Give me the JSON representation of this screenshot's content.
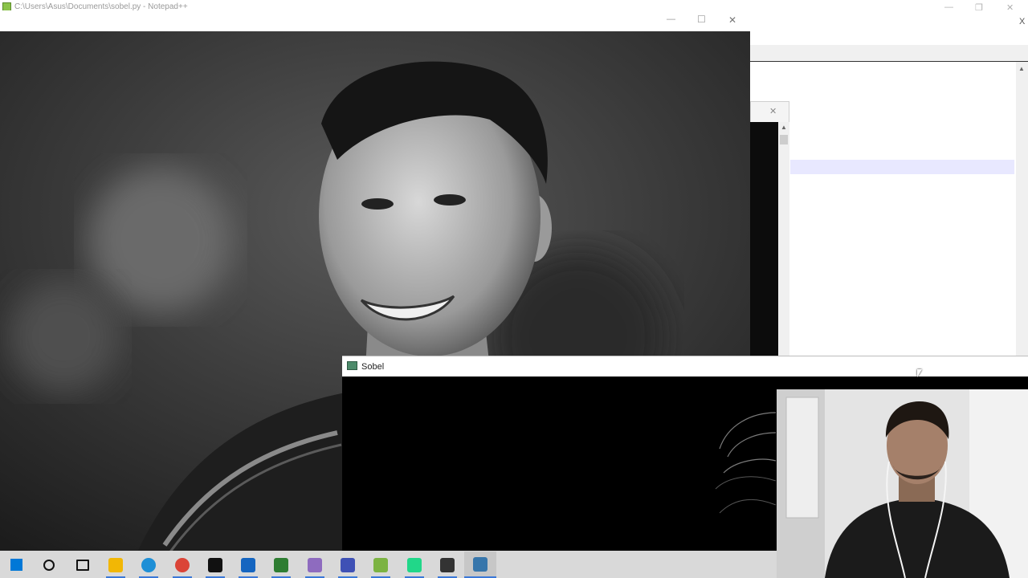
{
  "notepad": {
    "title": "C:\\Users\\Asus\\Documents\\sobel.py - Notepad++",
    "close_glyph": "X"
  },
  "image_window": {
    "title": "",
    "minimize": "—",
    "maximize": "☐",
    "close": "✕"
  },
  "dialog": {
    "close": "✕"
  },
  "sobel_window": {
    "title": "Sobel"
  },
  "taskbar": {
    "items": [
      {
        "icon": "windows-start-icon",
        "color": "#0078d7"
      },
      {
        "icon": "search-icon",
        "color": "#111111"
      },
      {
        "icon": "task-view-icon",
        "color": "#111111"
      },
      {
        "icon": "file-explorer-icon",
        "color": "#f2b705"
      },
      {
        "icon": "edge-icon",
        "color": "#1e8fd6"
      },
      {
        "icon": "chrome-icon",
        "color": "#db4437"
      },
      {
        "icon": "terminal-icon",
        "color": "#111111"
      },
      {
        "icon": "app-blue-icon",
        "color": "#1565c0"
      },
      {
        "icon": "bookmark-app-icon",
        "color": "#2e7d32"
      },
      {
        "icon": "paint-icon",
        "color": "#8e6bbf"
      },
      {
        "icon": "network-app-icon",
        "color": "#3f51b5"
      },
      {
        "icon": "notepad-plus-plus-icon",
        "color": "#7cb342"
      },
      {
        "icon": "pycharm-icon",
        "color": "#21d789"
      },
      {
        "icon": "speedometer-app-icon",
        "color": "#333333"
      },
      {
        "icon": "python-icon",
        "color": "#3776ab"
      }
    ]
  },
  "colors": {
    "taskbar_accent": "#3a78d8"
  }
}
